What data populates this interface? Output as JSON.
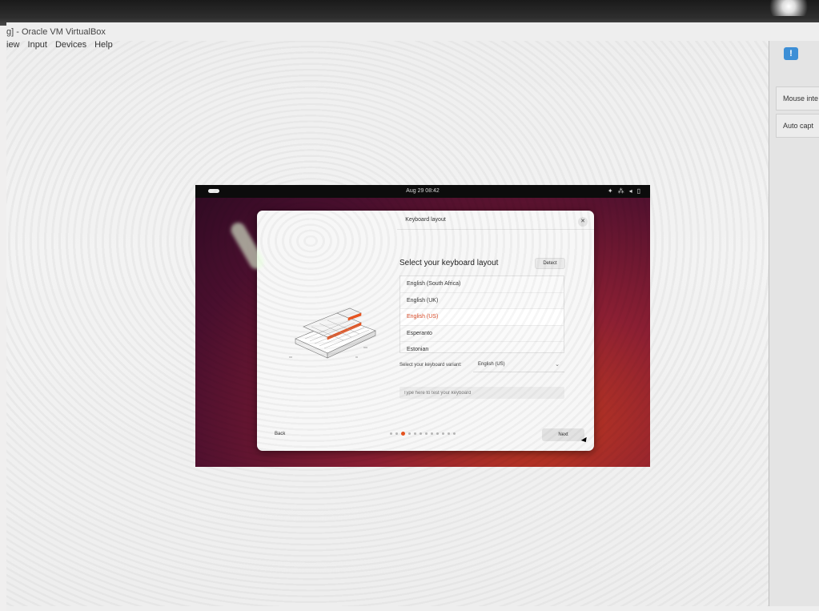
{
  "host": {
    "title": "g] - Oracle VM VirtualBox",
    "menu": [
      "iew",
      "Input",
      "Devices",
      "Help"
    ],
    "side_panel": {
      "icon": "info-icon",
      "items": [
        "Mouse inte",
        "Auto capt"
      ]
    }
  },
  "vm": {
    "top_bar": {
      "clock": "Aug 29 08:42",
      "status_icons": [
        "accessibility-icon",
        "network-icon",
        "volume-icon",
        "battery-icon"
      ]
    },
    "installer": {
      "title": "Keyboard layout",
      "heading": "Select your keyboard layout",
      "detect_label": "Detect",
      "layouts": [
        "English (South Africa)",
        "English (UK)",
        "English (US)",
        "Esperanto",
        "Estonian"
      ],
      "selected_layout": "English (US)",
      "variant_label": "Select your keyboard variant:",
      "variant_value": "English (US)",
      "test_placeholder": "Type here to test your keyboard",
      "back_label": "Back",
      "next_label": "Next",
      "progress": {
        "total_steps": 12,
        "current_step": 3
      },
      "accent_color": "#e95420"
    }
  }
}
